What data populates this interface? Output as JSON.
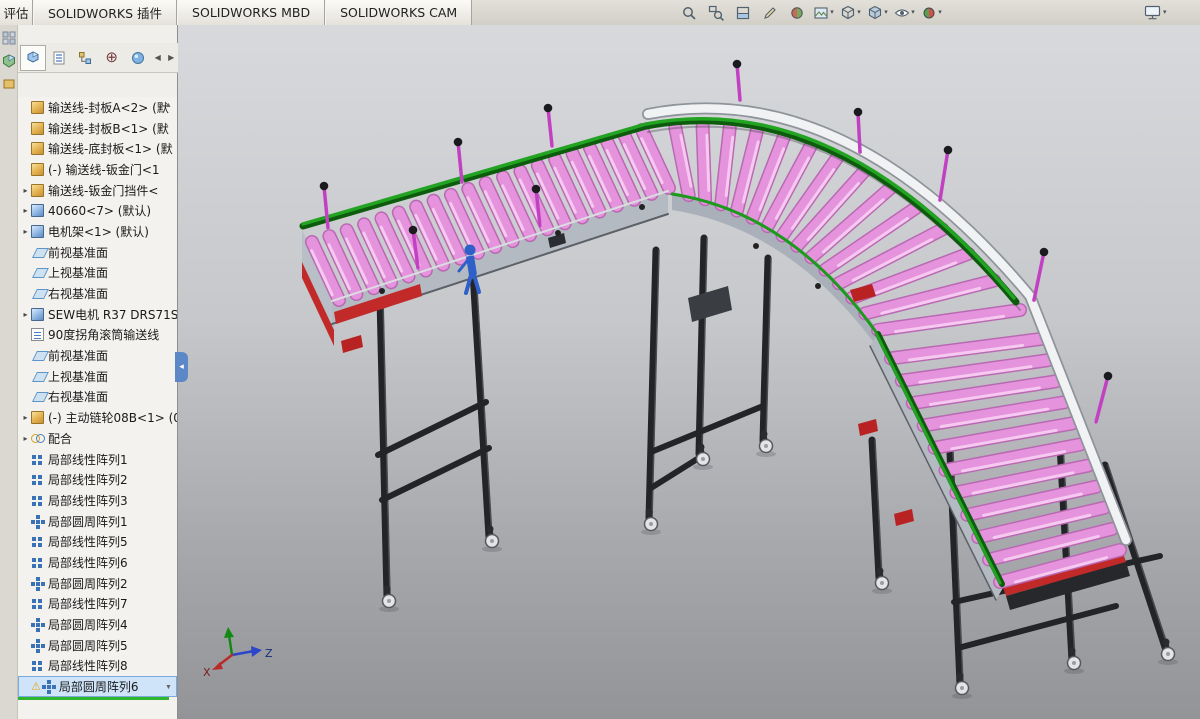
{
  "titlebar": {
    "tabs": [
      {
        "label": "评估"
      },
      {
        "label": "SOLIDWORKS 插件"
      },
      {
        "label": "SOLIDWORKS MBD"
      },
      {
        "label": "SOLIDWORKS CAM"
      }
    ]
  },
  "hud": {
    "icons": [
      "zoom-fit",
      "zoom-area",
      "section-view",
      "annotation",
      "appearance",
      "scene",
      "view-orientation",
      "display-style",
      "hide-show-items",
      "edit-appearance"
    ],
    "right_icon": "display-settings"
  },
  "panel": {
    "strip_icons": [
      "command-grid",
      "assembly-cube",
      "part-block"
    ],
    "tabs": [
      "featuremanager",
      "propertymanager",
      "configurationmanager",
      "dimxpertmanager",
      "displaymanager"
    ],
    "nav": {
      "prev": "◀",
      "next": "▶",
      "scroll_up": "▲",
      "scroll_down": "▼"
    },
    "tree": {
      "items": [
        {
          "label": "输送线-封板A<2> (默",
          "icon": "part"
        },
        {
          "label": "输送线-封板B<1> (默",
          "icon": "part"
        },
        {
          "label": "输送线-底封板<1> (默",
          "icon": "part"
        },
        {
          "label": "(-) 输送线-钣金门<1",
          "icon": "part"
        },
        {
          "label": "输送线-钣金门挡件<",
          "icon": "part",
          "arrow": true
        },
        {
          "label": "40660<7> (默认)",
          "icon": "part2",
          "arrow": true
        },
        {
          "label": "电机架<1> (默认)",
          "icon": "part2",
          "arrow": true
        },
        {
          "label": "前视基准面",
          "icon": "plane"
        },
        {
          "label": "上视基准面",
          "icon": "plane"
        },
        {
          "label": "右视基准面",
          "icon": "plane"
        },
        {
          "label": "SEW电机 R37 DRS71S",
          "icon": "part2",
          "arrow": true
        },
        {
          "label": "90度拐角滚筒输送线",
          "icon": "doc"
        },
        {
          "label": "前视基准面",
          "icon": "plane"
        },
        {
          "label": "上视基准面",
          "icon": "plane"
        },
        {
          "label": "右视基准面",
          "icon": "plane"
        },
        {
          "label": "(-) 主动链轮08B<1> (0",
          "icon": "part",
          "arrow": true
        },
        {
          "label": "配合",
          "icon": "mates",
          "arrow": true
        },
        {
          "label": "局部线性阵列1",
          "icon": "linpat"
        },
        {
          "label": "局部线性阵列2",
          "icon": "linpat"
        },
        {
          "label": "局部线性阵列3",
          "icon": "linpat"
        },
        {
          "label": "局部圆周阵列1",
          "icon": "cirpat"
        },
        {
          "label": "局部线性阵列5",
          "icon": "linpat"
        },
        {
          "label": "局部线性阵列6",
          "icon": "linpat"
        },
        {
          "label": "局部圆周阵列2",
          "icon": "cirpat"
        },
        {
          "label": "局部线性阵列7",
          "icon": "linpat"
        },
        {
          "label": "局部圆周阵列4",
          "icon": "cirpat"
        },
        {
          "label": "局部圆周阵列5",
          "icon": "cirpat"
        },
        {
          "label": "局部线性阵列8",
          "icon": "linpat"
        },
        {
          "label": "局部圆周阵列6",
          "icon": "cirpat",
          "selected": true,
          "warning": true
        }
      ]
    }
  },
  "viewport": {
    "triad": {
      "x": "X",
      "z": "Z"
    }
  },
  "colors": {
    "accent_green": "#1d9a1d",
    "roller_pink": "#e593dd",
    "rail_red": "#c22a2a",
    "frame_dark": "#232428",
    "selection": "#cfe4f9"
  }
}
